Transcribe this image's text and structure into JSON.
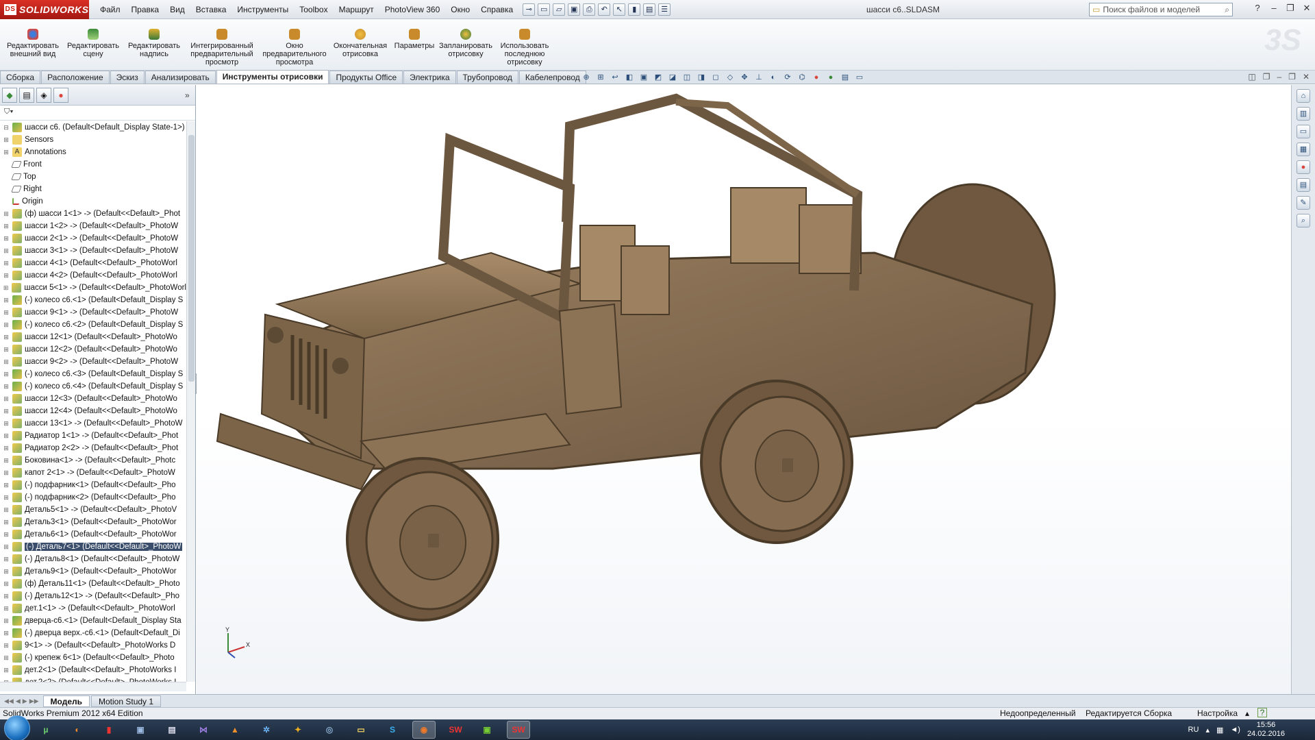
{
  "app": {
    "logo_text": "SOLIDWORKS",
    "document_title": "шасси c6..SLDASM",
    "search_placeholder": "Поиск файлов и моделей",
    "menu": [
      "Файл",
      "Правка",
      "Вид",
      "Вставка",
      "Инструменты",
      "Toolbox",
      "Маршрут",
      "PhotoView 360",
      "Окно",
      "Справка"
    ]
  },
  "ribbon": {
    "buttons": [
      {
        "label": "Редактировать внешний вид",
        "icon": "appearance-icon",
        "color": "#d9463c"
      },
      {
        "label": "Редактировать сцену",
        "icon": "scene-icon",
        "color": "#3b8a3a"
      },
      {
        "label": "Редактировать надпись",
        "icon": "decal-icon",
        "color": "#e0b030"
      },
      {
        "label": "Интегрированный предварительный просмотр",
        "icon": "integrated-preview-icon",
        "color": "#c98a2c"
      },
      {
        "label": "Окно предварительного просмотра",
        "icon": "preview-window-icon",
        "color": "#c98a2c"
      },
      {
        "label": "Окончательная отрисовка",
        "icon": "final-render-icon",
        "color": "#c98a2c"
      },
      {
        "label": "Параметры",
        "icon": "options-icon",
        "color": "#c98a2c"
      },
      {
        "label": "Запланировать отрисовку",
        "icon": "schedule-render-icon",
        "color": "#c98a2c"
      },
      {
        "label": "Использовать последнюю отрисовку",
        "icon": "recall-render-icon",
        "color": "#c98a2c"
      }
    ]
  },
  "command_tabs": [
    "Сборка",
    "Расположение",
    "Эскиз",
    "Анализировать",
    "Инструменты отрисовки",
    "Продукты Office",
    "Электрика",
    "Трубопровод",
    "Кабелепровод"
  ],
  "active_command_tab": "Инструменты отрисовки",
  "feature_tree": {
    "root": "шасси с6.  (Default<Default_Display State-1>)",
    "items": [
      {
        "label": "Sensors",
        "type": "sensor"
      },
      {
        "label": "Annotations",
        "type": "annot"
      },
      {
        "label": "Front",
        "type": "plane"
      },
      {
        "label": "Top",
        "type": "plane"
      },
      {
        "label": "Right",
        "type": "plane"
      },
      {
        "label": "Origin",
        "type": "origin"
      },
      {
        "label": "(ф) шасси 1<1> -> (Default<<Default>_Phot",
        "type": "part"
      },
      {
        "label": "шасси 1<2> -> (Default<<Default>_PhotoW",
        "type": "part"
      },
      {
        "label": "шасси 2<1> -> (Default<<Default>_PhotoW",
        "type": "part"
      },
      {
        "label": "шасси 3<1> -> (Default<<Default>_PhotoW",
        "type": "part"
      },
      {
        "label": "шасси 4<1> (Default<<Default>_PhotoWorl",
        "type": "part"
      },
      {
        "label": "шасси 4<2> (Default<<Default>_PhotoWorl",
        "type": "part"
      },
      {
        "label": "шасси 5<1> -> (Default<<Default>_PhotoWorl",
        "type": "part"
      },
      {
        "label": "(-) колесо с6.<1> (Default<Default_Display S",
        "type": "asm"
      },
      {
        "label": "шасси 9<1> -> (Default<<Default>_PhotoW",
        "type": "part"
      },
      {
        "label": "(-) колесо с6.<2> (Default<Default_Display S",
        "type": "asm"
      },
      {
        "label": "шасси 12<1> (Default<<Default>_PhotoWo",
        "type": "part"
      },
      {
        "label": "шасси 12<2> (Default<<Default>_PhotoWo",
        "type": "part"
      },
      {
        "label": "шасси 9<2> -> (Default<<Default>_PhotoW",
        "type": "part"
      },
      {
        "label": "(-) колесо с6.<3> (Default<Default_Display S",
        "type": "asm"
      },
      {
        "label": "(-) колесо с6.<4> (Default<Default_Display S",
        "type": "asm"
      },
      {
        "label": "шасси 12<3> (Default<<Default>_PhotoWo",
        "type": "part"
      },
      {
        "label": "шасси 12<4> (Default<<Default>_PhotoWo",
        "type": "part"
      },
      {
        "label": "шасси 13<1> -> (Default<<Default>_PhotoW",
        "type": "part"
      },
      {
        "label": "Радиатор 1<1> -> (Default<<Default>_Phot",
        "type": "part"
      },
      {
        "label": "Радиатор 2<2> -> (Default<<Default>_Phot",
        "type": "part"
      },
      {
        "label": "Боковина<1> -> (Default<<Default>_Photc",
        "type": "part"
      },
      {
        "label": "капот 2<1> -> (Default<<Default>_PhotoW",
        "type": "part"
      },
      {
        "label": "(-) подфарник<1> (Default<<Default>_Pho",
        "type": "part"
      },
      {
        "label": "(-) подфарник<2> (Default<<Default>_Pho",
        "type": "part"
      },
      {
        "label": "Деталь5<1> -> (Default<<Default>_PhotoV",
        "type": "part"
      },
      {
        "label": "Деталь3<1> (Default<<Default>_PhotoWor",
        "type": "part"
      },
      {
        "label": "Деталь6<1> (Default<<Default>_PhotoWor",
        "type": "part"
      },
      {
        "label": "(-) Деталь7<1> (Default<<Default>_PhotoW",
        "type": "part",
        "selected": true
      },
      {
        "label": "(-) Деталь8<1> (Default<<Default>_PhotoW",
        "type": "part"
      },
      {
        "label": "Деталь9<1> (Default<<Default>_PhotoWor",
        "type": "part"
      },
      {
        "label": "(ф) Деталь11<1> (Default<<Default>_Photo",
        "type": "part"
      },
      {
        "label": "(-) Деталь12<1> -> (Default<<Default>_Pho",
        "type": "part"
      },
      {
        "label": "дет.1<1> -> (Default<<Default>_PhotoWorl",
        "type": "part"
      },
      {
        "label": "дверца-с6.<1> (Default<Default_Display Sta",
        "type": "asm"
      },
      {
        "label": "(-) дверца верх.-с6.<1> (Default<Default_Di",
        "type": "asm"
      },
      {
        "label": "9<1> -> (Default<<Default>_PhotoWorks D",
        "type": "part"
      },
      {
        "label": "(-) крепеж 6<1> (Default<<Default>_Photo",
        "type": "part"
      },
      {
        "label": "дет.2<1> (Default<<Default>_PhotoWorks I",
        "type": "part"
      },
      {
        "label": "дет.2<2> (Default<<Default>_PhotoWorks I",
        "type": "part"
      }
    ]
  },
  "bottom_tabs": [
    "Модель",
    "Motion Study 1"
  ],
  "active_bottom_tab": "Модель",
  "status": {
    "edition": "SolidWorks Premium 2012 x64 Edition",
    "definition": "Недоопределенный",
    "editing": "Редактируется Сборка",
    "custom": "Настройка"
  },
  "triad_labels": {
    "y": "Y",
    "x": "X"
  },
  "taskbar": {
    "lang": "RU",
    "time": "15:56",
    "date": "24.02.2016"
  },
  "colors": {
    "brand_red": "#c8241b",
    "wood": "#7a6248",
    "selection": "#3a4e6b"
  }
}
